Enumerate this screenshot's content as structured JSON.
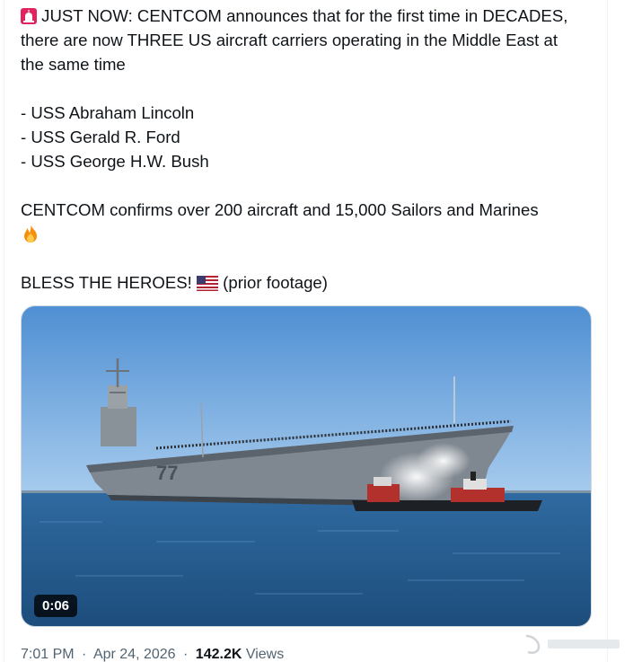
{
  "tweet": {
    "alert_emoji": "🚨",
    "lines": [
      "JUST NOW: CENTCOM announces that for the first time in DECADES,",
      "there are now THREE US aircraft carriers operating in the Middle East at",
      "the same time"
    ],
    "carriers": [
      "- USS Abraham Lincoln",
      "- USS Gerald R. Ford",
      "- USS George H.W. Bush"
    ],
    "confirm_line": "CENTCOM confirms over 200 aircraft and 15,000 Sailors and Marines",
    "fire_emoji": "🔥",
    "bless_text": "BLESS THE HEROES!",
    "flag_emoji": "🇺🇸",
    "prior_text": "(prior footage)"
  },
  "media": {
    "duration": "0:06",
    "alt_description": "Aircraft carrier with tugboats at sea"
  },
  "meta": {
    "time": "7:01 PM",
    "date": "Apr 24, 2026",
    "views_count": "142.2K",
    "views_label": "Views",
    "separator": "·"
  },
  "colors": {
    "text": "#0f1419",
    "secondary": "#536471",
    "border": "#cfd9de",
    "sky": "#6fa6dc",
    "sea": "#2a5f91"
  }
}
